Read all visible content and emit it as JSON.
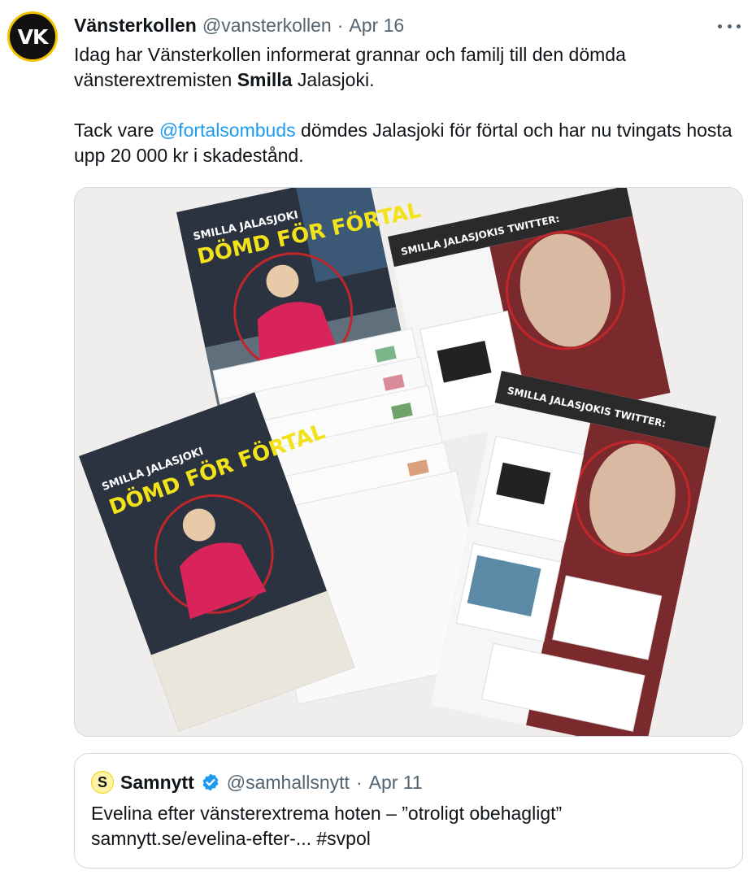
{
  "author": {
    "avatar_text": "VK",
    "name": "Vänsterkollen",
    "handle": "@vansterkollen",
    "separator": "·",
    "date": "Apr 16"
  },
  "tweet": {
    "line1_a": "Idag har Vänsterkollen informerat grannar och familj till den dömda vänsterextremisten ",
    "line1_bold": "Smilla",
    "line1_b": " Jalasjoki.",
    "line2_a": "Tack vare ",
    "line2_mention": "@fortalsombuds",
    "line2_b": " dömdes Jalasjoki för förtal och har nu tvingats hosta upp 20 000 kr i skadestånd."
  },
  "media": {
    "flyer_label": "SMILLA JALASJOKI",
    "flyer_headline": "DÖMD FÖR FÖRTAL",
    "twitter_label": "SMILLA JALASJOKIS TWITTER:",
    "colors": {
      "headline": "#f1e21a",
      "circle": "#c0262a",
      "sweater": "#d8245a",
      "paper": "#fbfbfb"
    }
  },
  "quote": {
    "avatar_text": "S",
    "name": "Samnytt",
    "handle": "@samhallsnytt",
    "separator": "·",
    "date": "Apr 11",
    "text_line1": "Evelina efter vänsterextrema hoten – ”otroligt obehagligt”",
    "text_line2": "samnytt.se/evelina-efter-... #svpol"
  },
  "icons": [
    "more-icon",
    "verified-badge-icon"
  ],
  "colors": {
    "text": "#0f1419",
    "secondary": "#536471",
    "link": "#1d9bf0",
    "border": "#cfd9de"
  }
}
